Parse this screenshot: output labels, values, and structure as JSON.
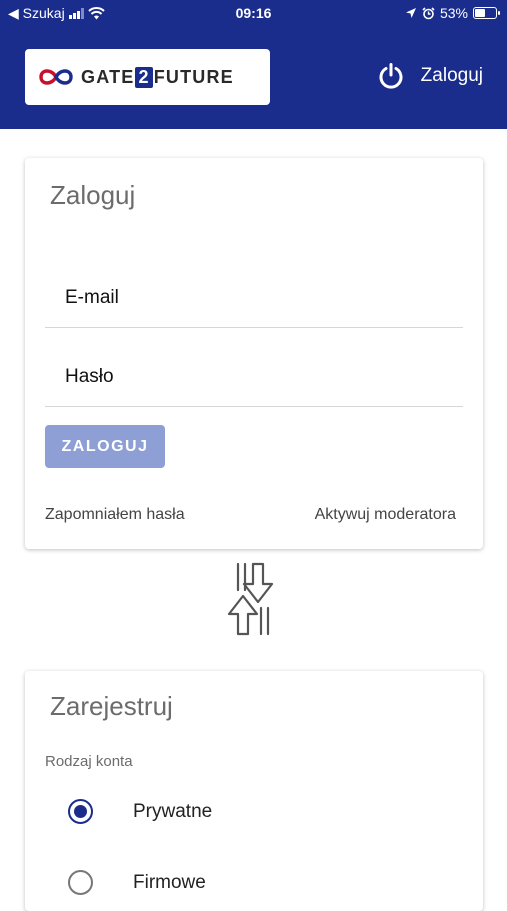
{
  "status_bar": {
    "back_label": "◀ Szukaj",
    "time": "09:16",
    "battery": "53%",
    "battery_level": 0.53
  },
  "header": {
    "logo_text_a": "GATE",
    "logo_text_b": "2",
    "logo_text_c": "FUTURE",
    "login_label": "Zaloguj",
    "icons": {
      "power": "power-icon",
      "logo": "infinity-logo-icon"
    }
  },
  "login_card": {
    "title": "Zaloguj",
    "email_placeholder": "E-mail",
    "password_placeholder": "Hasło",
    "submit_label": "ZALOGUJ",
    "forgot_password": "Zapomniałem hasła",
    "activate_moderator": "Aktywuj moderatora"
  },
  "register_card": {
    "title": "Zarejestruj",
    "account_type_label": "Rodzaj konta",
    "options": [
      {
        "label": "Prywatne",
        "selected": true
      },
      {
        "label": "Firmowe",
        "selected": false
      }
    ]
  },
  "colors": {
    "primary": "#1a2d8c",
    "button_disabled": "#8e9fd6",
    "logo_red": "#c8102e"
  }
}
